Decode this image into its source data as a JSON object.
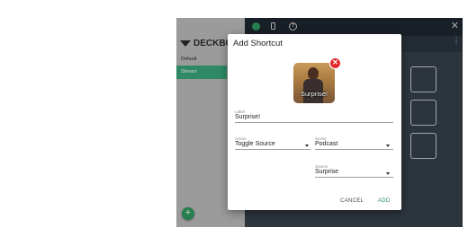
{
  "sidebar": {
    "logo_text": "DECKBOA",
    "decks": [
      {
        "label": "Default"
      },
      {
        "label": "Stream"
      }
    ],
    "add_button": "+"
  },
  "topbar": {
    "help_glyph": "?",
    "close_glyph": "✕",
    "more_glyph": "⋮"
  },
  "dialog": {
    "title": "Add Shortcut",
    "image": {
      "caption": "Surprise!",
      "remove_glyph": "✕"
    },
    "label": {
      "caption": "Label",
      "value": "Surprise!"
    },
    "action": {
      "caption": "Action",
      "value": "Toggle Source"
    },
    "scene": {
      "caption": "Scene",
      "value": "Podcast"
    },
    "source": {
      "caption": "Source",
      "value": "Surprise"
    },
    "cancel_label": "CANCEL",
    "add_label": "ADD"
  },
  "colors": {
    "accent": "#3aa87a",
    "dark_bg": "#2b3540",
    "danger": "#e22b2b"
  }
}
